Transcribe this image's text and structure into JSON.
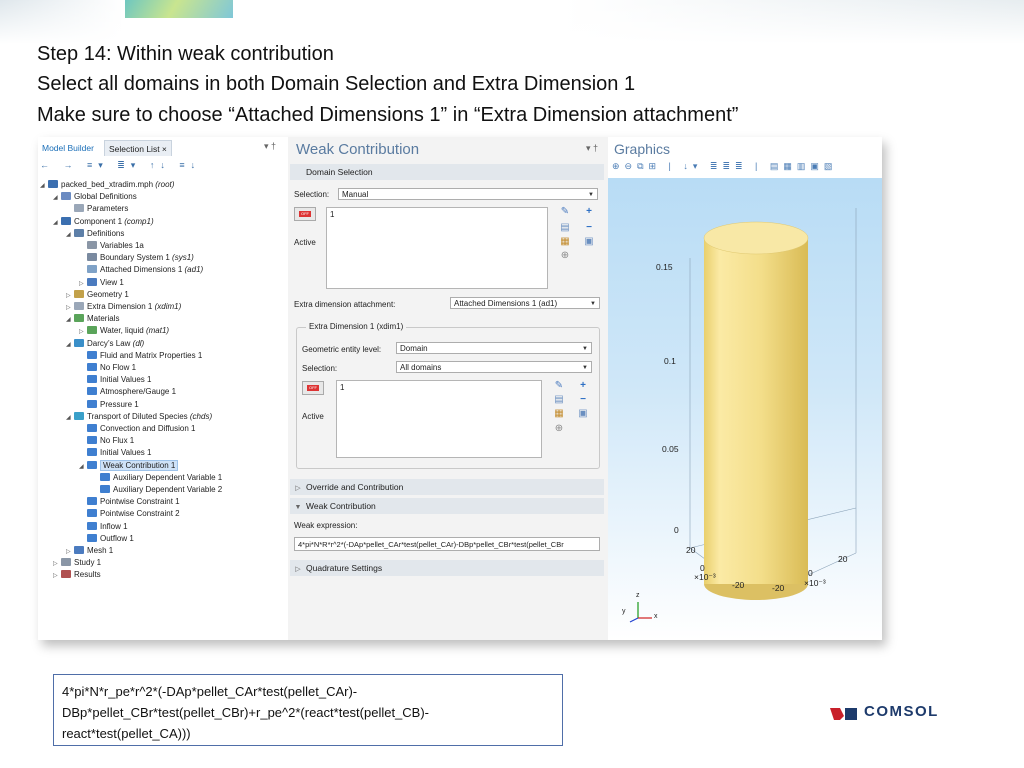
{
  "instructions": [
    "Step 14: Within weak contribution",
    "Select all domains in both Domain Selection and Extra Dimension 1",
    "Make sure to choose “Attached Dimensions 1” in “Extra Dimension attachment”"
  ],
  "left_panel": {
    "tabs": [
      "Model Builder",
      "Selection List ×"
    ],
    "pin": "▾ †",
    "toolbar": "← → ≡▾ ≣▾ ↑↓ ≡↓",
    "tree": [
      {
        "label": "packed_bed_xtradim.mph",
        "note": "(root)",
        "icon": "model-icon",
        "color": "#3b6fb0",
        "twisty": "◢"
      },
      {
        "label": "Global Definitions",
        "note": "",
        "icon": "global-definitions-icon",
        "color": "#6b8bc2",
        "twisty": "◢"
      },
      {
        "label": "Parameters",
        "note": "",
        "icon": "parameters-icon",
        "color": "#9aa7b8",
        "twisty": ""
      },
      {
        "label": "Component 1",
        "note": "(comp1)",
        "icon": "component-icon",
        "color": "#3b6fb0",
        "twisty": "◢"
      },
      {
        "label": "Definitions",
        "note": "",
        "icon": "definitions-icon",
        "color": "#5d7fa8",
        "twisty": "◢"
      },
      {
        "label": "Variables 1a",
        "note": "",
        "icon": "variables-icon",
        "color": "#8a96a6",
        "twisty": ""
      },
      {
        "label": "Boundary System 1",
        "note": "(sys1)",
        "icon": "boundary-system-icon",
        "color": "#7a8aa0",
        "twisty": ""
      },
      {
        "label": "Attached Dimensions 1",
        "note": "(ad1)",
        "icon": "attached-dimensions-icon",
        "color": "#7fa2c7",
        "twisty": ""
      },
      {
        "label": "View 1",
        "note": "",
        "icon": "view-icon",
        "color": "#4b7bbf",
        "twisty": "▷"
      },
      {
        "label": "Geometry 1",
        "note": "",
        "icon": "geometry-icon",
        "color": "#c2a14a",
        "twisty": "▷"
      },
      {
        "label": "Extra Dimension 1",
        "note": "(xdim1)",
        "icon": "extra-dimension-icon",
        "color": "#9aa7b8",
        "twisty": "▷"
      },
      {
        "label": "Materials",
        "note": "",
        "icon": "materials-icon",
        "color": "#5aa45a",
        "twisty": "◢"
      },
      {
        "label": "Water, liquid",
        "note": "(mat1)",
        "icon": "material-icon",
        "color": "#5aa45a",
        "twisty": "▷"
      },
      {
        "label": "Darcy’s Law",
        "note": "(dl)",
        "icon": "darcys-law-icon",
        "color": "#3a8fc9",
        "twisty": "◢"
      },
      {
        "label": "Fluid and Matrix Properties 1",
        "note": "",
        "icon": "physics-node-icon",
        "color": "#3f7fd0",
        "twisty": ""
      },
      {
        "label": "No Flow 1",
        "note": "",
        "icon": "physics-node-icon",
        "color": "#3f7fd0",
        "twisty": ""
      },
      {
        "label": "Initial Values 1",
        "note": "",
        "icon": "physics-node-icon",
        "color": "#3f7fd0",
        "twisty": ""
      },
      {
        "label": "Atmosphere/Gauge 1",
        "note": "",
        "icon": "physics-node-icon",
        "color": "#3f7fd0",
        "twisty": ""
      },
      {
        "label": "Pressure 1",
        "note": "",
        "icon": "physics-node-icon",
        "color": "#3f7fd0",
        "twisty": ""
      },
      {
        "label": "Transport of Diluted Species",
        "note": "(chds)",
        "icon": "transport-icon",
        "color": "#3aa0c9",
        "twisty": "◢"
      },
      {
        "label": "Convection and Diffusion 1",
        "note": "",
        "icon": "physics-node-icon",
        "color": "#3f7fd0",
        "twisty": ""
      },
      {
        "label": "No Flux 1",
        "note": "",
        "icon": "physics-node-icon",
        "color": "#3f7fd0",
        "twisty": ""
      },
      {
        "label": "Initial Values 1",
        "note": "",
        "icon": "physics-node-icon",
        "color": "#3f7fd0",
        "twisty": ""
      },
      {
        "label": "Weak Contribution 1",
        "note": "",
        "icon": "physics-node-icon",
        "color": "#3f7fd0",
        "twisty": "◢",
        "selected": true
      },
      {
        "label": "Auxiliary Dependent Variable 1",
        "note": "",
        "icon": "physics-node-icon",
        "color": "#3f7fd0",
        "twisty": ""
      },
      {
        "label": "Auxiliary Dependent Variable 2",
        "note": "",
        "icon": "physics-node-icon",
        "color": "#3f7fd0",
        "twisty": ""
      },
      {
        "label": "Pointwise Constraint 1",
        "note": "",
        "icon": "physics-node-icon",
        "color": "#3f7fd0",
        "twisty": ""
      },
      {
        "label": "Pointwise Constraint 2",
        "note": "",
        "icon": "physics-node-icon",
        "color": "#3f7fd0",
        "twisty": ""
      },
      {
        "label": "Inflow 1",
        "note": "",
        "icon": "physics-node-icon",
        "color": "#3f7fd0",
        "twisty": ""
      },
      {
        "label": "Outflow 1",
        "note": "",
        "icon": "physics-node-icon",
        "color": "#3f7fd0",
        "twisty": ""
      },
      {
        "label": "Mesh 1",
        "note": "",
        "icon": "mesh-icon",
        "color": "#4b7bbf",
        "twisty": "▷"
      },
      {
        "label": "Study 1",
        "note": "",
        "icon": "study-icon",
        "color": "#8a96a6",
        "twisty": "▷"
      },
      {
        "label": "Results",
        "note": "",
        "icon": "results-icon",
        "color": "#b05050",
        "twisty": "▷"
      }
    ]
  },
  "settings": {
    "title": "Weak Contribution",
    "pin": "▾ †",
    "domain_selection": {
      "header": "Domain Selection",
      "selection_label": "Selection:",
      "selection_value": "Manual",
      "list_value": "1",
      "active_label": "Active"
    },
    "extra_dim_attach_label": "Extra dimension attachment:",
    "extra_dim_attach_value": "Attached Dimensions 1 (ad1)",
    "extra_dim_group": {
      "title": "Extra Dimension 1 (xdim1)",
      "geom_level_label": "Geometric entity level:",
      "geom_level_value": "Domain",
      "selection_label": "Selection:",
      "selection_value": "All domains",
      "list_value": "1",
      "active_label": "Active"
    },
    "override_header": "Override and Contribution",
    "weak_header": "Weak Contribution",
    "weak_expr_label": "Weak expression:",
    "weak_expr_value": "4*pi*N*R*r^2*(-DAp*pellet_CAr*test(pellet_CAr)-DBp*pellet_CBr*test(pellet_CBr",
    "quadrature_header": "Quadrature Settings"
  },
  "graphics": {
    "title": "Graphics",
    "toolbar": "⊕⊖⧉⊞ | ↓▾ ≣≣≣ | ▤▦▥▣▧",
    "z_ticks": [
      "0.15",
      "0.1",
      "0.05",
      "0"
    ],
    "x_labels": [
      "20",
      "0",
      "×10⁻³",
      "-20"
    ],
    "y_labels": [
      "20",
      "0",
      "-20",
      "×10⁻³"
    ],
    "triad": {
      "x": "x",
      "y": "y",
      "z": "z"
    },
    "colors": {
      "cylinder": "#f3de8a",
      "background_top": "#b8dcf5"
    }
  },
  "expression_box": {
    "lines": [
      "4*pi*N*r_pe*r^2*(-DAp*pellet_CAr*test(pellet_CAr)-",
      "DBp*pellet_CBr*test(pellet_CBr)+r_pe^2*(react*test(pellet_CB)-",
      "react*test(pellet_CA)))"
    ]
  },
  "logo": {
    "text": "COMSOL",
    "color": "#1d3a6b",
    "accent": "#c8202a"
  }
}
